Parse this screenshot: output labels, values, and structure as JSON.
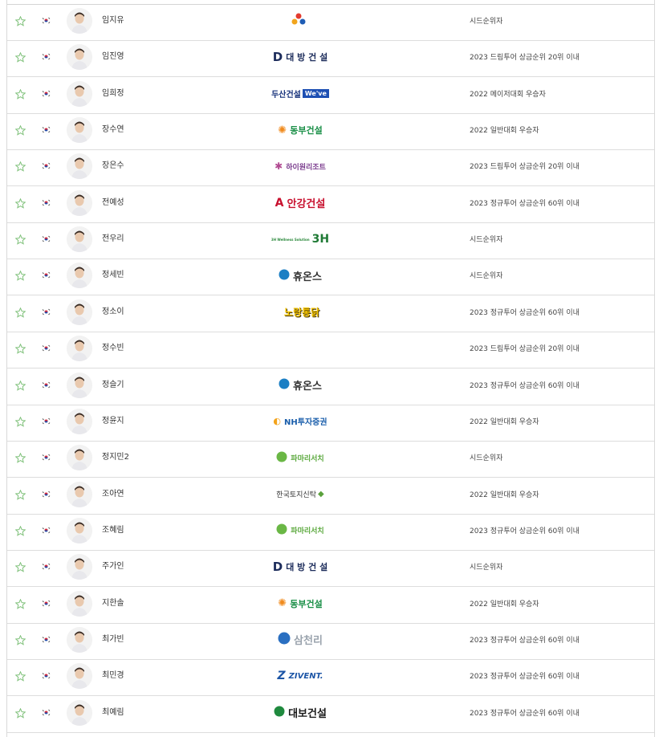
{
  "colors": {
    "star_outline": "#7fc17a",
    "row_border": "#dddddd",
    "flag_red": "#d6293b",
    "flag_blue": "#1f4aa8"
  },
  "rows": [
    {
      "name": "임지유",
      "sponsor": {
        "icon": "cj-logo-icon",
        "text": ""
      },
      "qualification": "시드순위자"
    },
    {
      "name": "임진영",
      "sponsor": {
        "icon": "daebang-logo-icon",
        "text": "대 방 건 설"
      },
      "qualification": "2023 드림투어 상금순위 20위 이내"
    },
    {
      "name": "임희정",
      "sponsor": {
        "icon": "doosan-logo-icon",
        "text": "두산건설",
        "badge": "We've"
      },
      "qualification": "2022 메이저대회 우승자"
    },
    {
      "name": "장수연",
      "sponsor": {
        "icon": "dongbu-logo-icon",
        "text": "동부건설"
      },
      "qualification": "2022 일반대회 우승자"
    },
    {
      "name": "장은수",
      "sponsor": {
        "icon": "high1-logo-icon",
        "text": "하이원리조트"
      },
      "qualification": "2023 드림투어 상금순위 20위 이내"
    },
    {
      "name": "전예성",
      "sponsor": {
        "icon": "ahnkang-logo-icon",
        "text": "안강건설"
      },
      "qualification": "2023 정규투어 상금순위 60위 이내"
    },
    {
      "name": "전우리",
      "sponsor": {
        "icon": "3h-logo-icon",
        "text": "3H Wellness Solution"
      },
      "qualification": "시드순위자"
    },
    {
      "name": "정세빈",
      "sponsor": {
        "icon": "huons-logo-icon",
        "text": "휴온스"
      },
      "qualification": "시드순위자"
    },
    {
      "name": "정소이",
      "sponsor": {
        "icon": "nolang-logo-icon",
        "text": "노랑통닭"
      },
      "qualification": "2023 정규투어 상금순위 60위 이내"
    },
    {
      "name": "정수빈",
      "sponsor": {
        "icon": "",
        "text": ""
      },
      "qualification": "2023 드림투어 상금순위 20위 이내"
    },
    {
      "name": "정슬기",
      "sponsor": {
        "icon": "huons-logo-icon",
        "text": "휴온스"
      },
      "qualification": "2023 정규투어 상금순위 60위 이내"
    },
    {
      "name": "정윤지",
      "sponsor": {
        "icon": "nh-logo-icon",
        "text": "NH투자증권"
      },
      "qualification": "2022 일반대회 우승자"
    },
    {
      "name": "정지민2",
      "sponsor": {
        "icon": "pharma-logo-icon",
        "text": "파마리서치"
      },
      "qualification": "시드순위자"
    },
    {
      "name": "조아연",
      "sponsor": {
        "icon": "kland-logo-icon",
        "text": "한국토지신탁"
      },
      "qualification": "2022 일반대회 우승자"
    },
    {
      "name": "조혜림",
      "sponsor": {
        "icon": "pharma-logo-icon",
        "text": "파마리서치"
      },
      "qualification": "2023 정규투어 상금순위 60위 이내"
    },
    {
      "name": "주가인",
      "sponsor": {
        "icon": "daebang-logo-icon",
        "text": "대 방 건 설"
      },
      "qualification": "시드순위자"
    },
    {
      "name": "지한솔",
      "sponsor": {
        "icon": "dongbu-logo-icon",
        "text": "동부건설"
      },
      "qualification": "2022 일반대회 우승자"
    },
    {
      "name": "최가빈",
      "sponsor": {
        "icon": "samchully-logo-icon",
        "text": "삼천리"
      },
      "qualification": "2023 정규투어 상금순위 60위 이내"
    },
    {
      "name": "최민경",
      "sponsor": {
        "icon": "zivent-logo-icon",
        "text": "ZIVENT."
      },
      "qualification": "2023 정규투어 상금순위 60위 이내"
    },
    {
      "name": "최예림",
      "sponsor": {
        "icon": "daebo-logo-icon",
        "text": "대보건설"
      },
      "qualification": "2023 정규투어 상금순위 60위 이내"
    }
  ]
}
